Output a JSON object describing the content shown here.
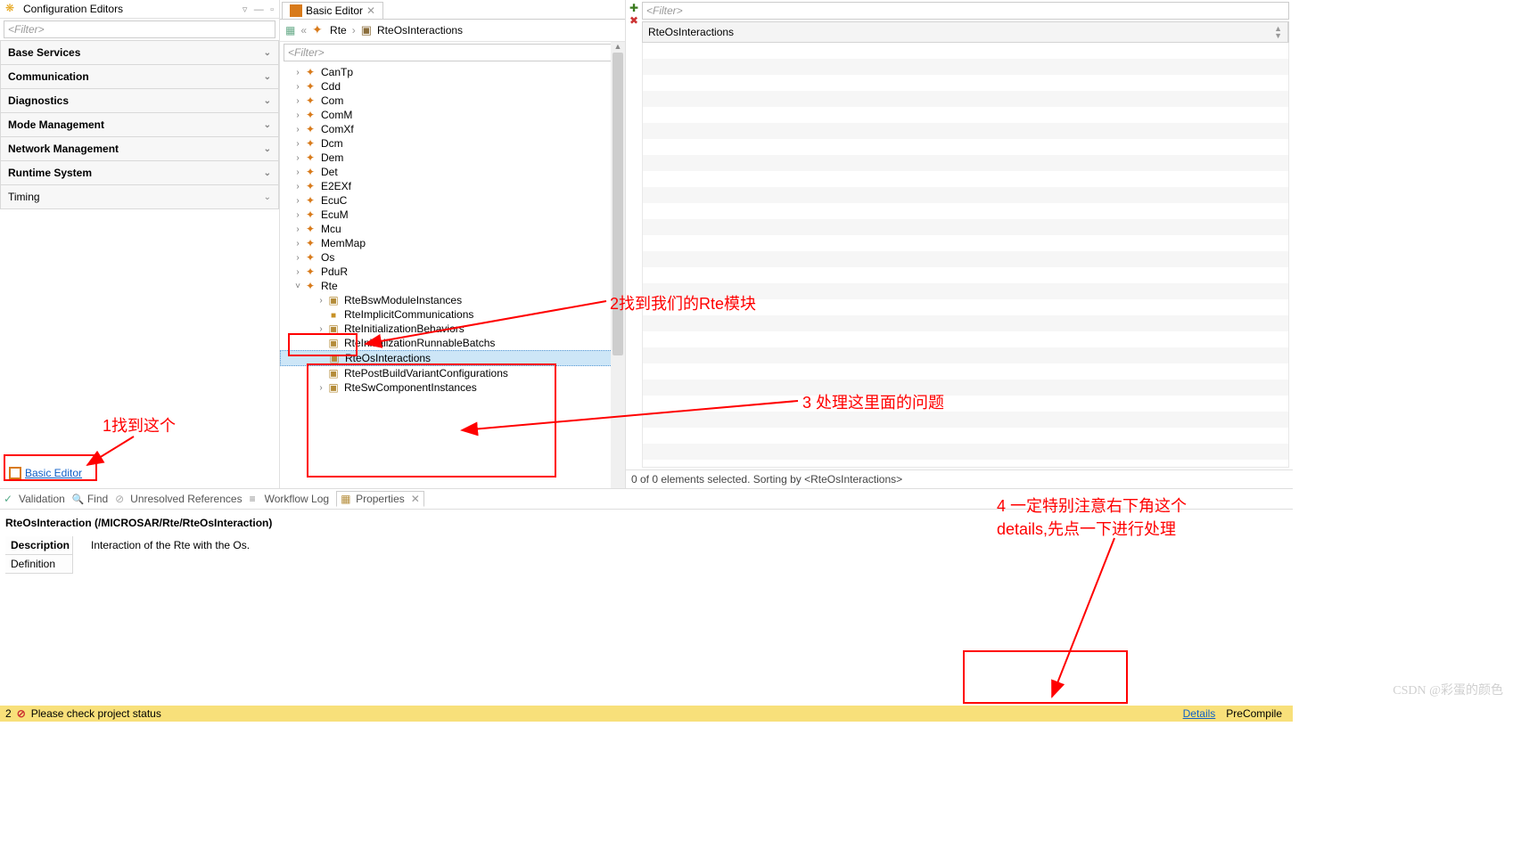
{
  "left": {
    "title": "Configuration Editors",
    "filter": "<Filter>",
    "items": [
      {
        "label": "Base Services",
        "bold": true
      },
      {
        "label": "Communication",
        "bold": true
      },
      {
        "label": "Diagnostics",
        "bold": true
      },
      {
        "label": "Mode Management",
        "bold": true
      },
      {
        "label": "Network Management",
        "bold": true
      },
      {
        "label": "Runtime System",
        "bold": true
      },
      {
        "label": "Timing",
        "bold": false
      }
    ],
    "link": "Basic Editor"
  },
  "center": {
    "tab": "Basic Editor",
    "breadcrumb": [
      "Rte",
      "RteOsInteractions"
    ],
    "filter": "<Filter>",
    "tree": [
      {
        "label": "CanTp",
        "type": "puzzle",
        "expand": true
      },
      {
        "label": "Cdd",
        "type": "puzzle",
        "expand": true
      },
      {
        "label": "Com",
        "type": "puzzle",
        "expand": true
      },
      {
        "label": "ComM",
        "type": "puzzle",
        "expand": true
      },
      {
        "label": "ComXf",
        "type": "puzzle",
        "expand": true
      },
      {
        "label": "Dcm",
        "type": "puzzle",
        "expand": true
      },
      {
        "label": "Dem",
        "type": "puzzle",
        "expand": true
      },
      {
        "label": "Det",
        "type": "puzzle",
        "expand": true
      },
      {
        "label": "E2EXf",
        "type": "puzzle",
        "expand": true
      },
      {
        "label": "EcuC",
        "type": "puzzle",
        "expand": true
      },
      {
        "label": "EcuM",
        "type": "puzzle",
        "expand": true
      },
      {
        "label": "Mcu",
        "type": "puzzle",
        "expand": true
      },
      {
        "label": "MemMap",
        "type": "puzzle",
        "expand": true
      },
      {
        "label": "Os",
        "type": "puzzle",
        "expand": true
      },
      {
        "label": "PduR",
        "type": "puzzle",
        "expand": true
      },
      {
        "label": "Rte",
        "type": "puzzle",
        "expand": false,
        "open": true
      }
    ],
    "rteChildren": [
      {
        "label": "RteBswModuleInstances",
        "type": "folder",
        "expand": true
      },
      {
        "label": "RteImplicitCommunications",
        "type": "block",
        "expand": false
      },
      {
        "label": "RteInitializationBehaviors",
        "type": "folder",
        "expand": true
      },
      {
        "label": "RteInitializationRunnableBatchs",
        "type": "folder",
        "expand": false
      },
      {
        "label": "RteOsInteractions",
        "type": "folder",
        "expand": false,
        "selected": true
      },
      {
        "label": "RtePostBuildVariantConfigurations",
        "type": "folder",
        "expand": false
      },
      {
        "label": "RteSwComponentInstances",
        "type": "folder",
        "expand": true
      }
    ]
  },
  "right": {
    "filter": "<Filter>",
    "column": "RteOsInteractions",
    "status": "0 of 0 elements selected. Sorting by  <RteOsInteractions>"
  },
  "bottom": {
    "tabs": [
      "Validation",
      "Find",
      "Unresolved References",
      "Workflow Log",
      "Properties"
    ],
    "propsTitle": "RteOsInteraction (/MICROSAR/Rte/RteOsInteraction)",
    "descLabel": "Description",
    "defLabel": "Definition",
    "descValue": "Interaction of the Rte with the Os."
  },
  "footer": {
    "count": "2",
    "msg": "Please check project status",
    "details": "Details",
    "pre": "PreCompile"
  },
  "annotations": {
    "a1": "1找到这个",
    "a2": "2找到我们的Rte模块",
    "a3": "3  处理这里面的问题",
    "a4a": "4  一定特别注意右下角这个",
    "a4b": "details,先点一下进行处理"
  },
  "watermark": "CSDN @彩蛋的颜色"
}
